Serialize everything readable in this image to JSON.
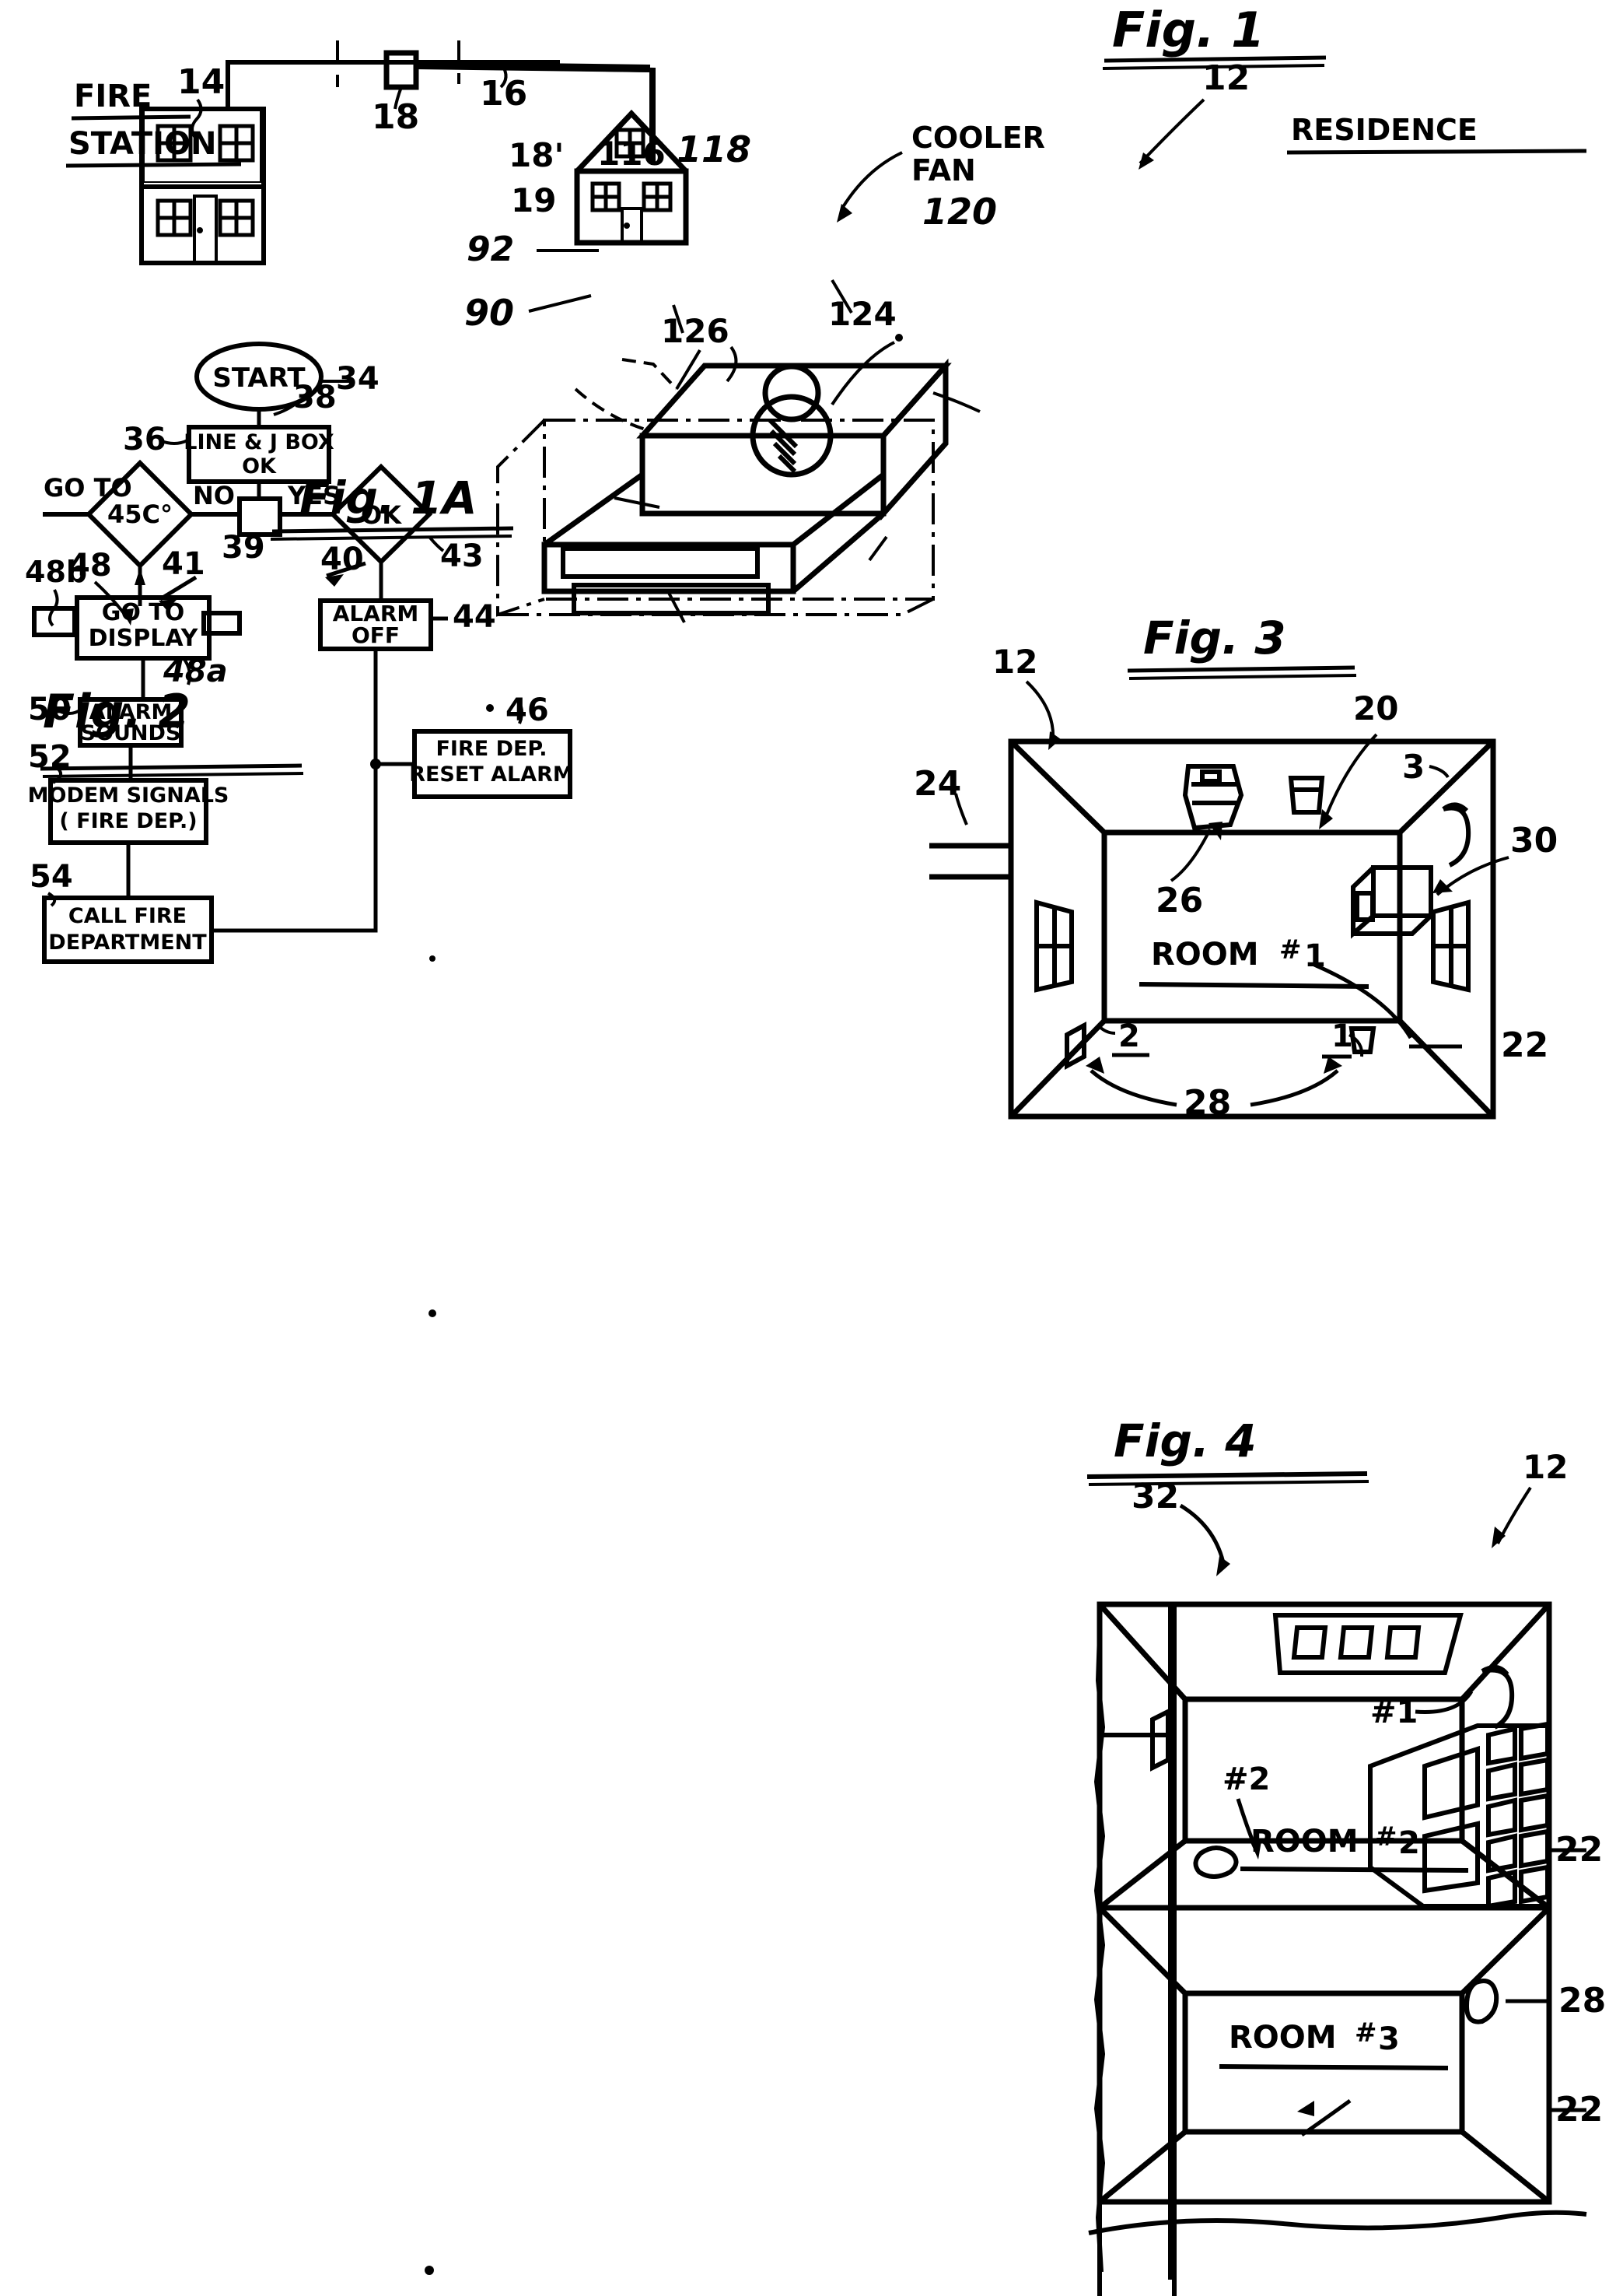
{
  "sheet": {
    "kind": "patent-drawing-sheet",
    "figures": [
      "Fig. 1",
      "Fig. 1A",
      "Fig. 2",
      "Fig. 3",
      "Fig. 4"
    ]
  },
  "fig1": {
    "title": "Fig. 1",
    "labels": {
      "fire_station": "FIRE\nSTATION",
      "fire_station_line1": "FIRE",
      "fire_station_line2": "STATION",
      "residence": "RESIDENCE"
    },
    "refs": {
      "fire_station_building": "14",
      "junction_box": "18",
      "line": "16",
      "residence_house": "12"
    }
  },
  "fig1a": {
    "title": "Fig. 1A",
    "labels": {
      "cooler_fan": "COOLER\nFAN",
      "cooler_fan_line1": "COOLER",
      "cooler_fan_line2": "FAN"
    },
    "refs": {
      "detail_jbox": "18'",
      "bracket": "116",
      "fan_shaft": "118",
      "enclosure_leader": "19",
      "fan_arrow": "120",
      "upper_slot": "92",
      "lower_slot": "90",
      "slot_leader": "126",
      "housing": "124"
    }
  },
  "fig2": {
    "title": "Fig. 2",
    "nodes": [
      {
        "id": "start",
        "ref": "34",
        "text": "START",
        "shape": "oval"
      },
      {
        "id": "lineok",
        "ref": "36",
        "text": "LINE & J BOX\nOK",
        "shape": "rect",
        "line1": "LINE & J BOX",
        "line2": "OK"
      },
      {
        "id": "dec45",
        "ref": "41",
        "text": "45C°",
        "shape": "diamond"
      },
      {
        "id": "conn",
        "ref": "39",
        "text": "",
        "shape": "small-rect"
      },
      {
        "id": "ok",
        "ref": "43",
        "text": "OK",
        "shape": "diamond"
      },
      {
        "id": "goto",
        "ref": "48",
        "text": "GO TO\nDISPLAY",
        "shape": "rect",
        "line1": "GO TO",
        "line2": "DISPLAY"
      },
      {
        "id": "alarmoff",
        "ref": "44",
        "text": "ALARM\nOFF",
        "shape": "rect",
        "line1": "ALARM",
        "line2": "OFF"
      },
      {
        "id": "sounds",
        "ref": "50",
        "text": "ALARM\nSOUNDS",
        "shape": "rect",
        "line1": "ALARM",
        "line2": "SOUNDS"
      },
      {
        "id": "reset",
        "ref": "46",
        "text": "FIRE DEP.\nRESET ALARM",
        "shape": "rect",
        "line1": "FIRE DEP.",
        "line2": "RESET ALARM"
      },
      {
        "id": "modem",
        "ref": "52",
        "text": "MODEM SIGNALS\n( FIRE DEP.)",
        "shape": "rect",
        "line1": "MODEM SIGNALS",
        "line2": "( FIRE DEP.)"
      },
      {
        "id": "call",
        "ref": "54",
        "text": "CALL FIRE\nDEPARTMENT",
        "shape": "rect",
        "line1": "CALL FIRE",
        "line2": "DEPARTMENT"
      }
    ],
    "edge_labels": {
      "goto_left": "GO TO",
      "no": "NO",
      "yes": "YES"
    },
    "refs": {
      "start": "34",
      "start_stem": "38",
      "lineok": "36",
      "connector": "39",
      "decision_out": "41",
      "ok_diamond": "43",
      "ok_out": "40",
      "alarm_off": "44",
      "reset_alarm": "46",
      "goto_display": "48",
      "goto_display_box": "48a",
      "aux_box": "48b",
      "alarm_sounds": "50",
      "modem_signals": "52",
      "call_fire": "54"
    }
  },
  "fig3": {
    "title": "Fig. 3",
    "labels": {
      "room": "ROOM  #1",
      "room_word": "ROOM",
      "room_hash": "#",
      "room_num": "1",
      "sensor_two": "2",
      "sensor_one": "1",
      "wall_ref": "3"
    },
    "refs": {
      "residence": "12",
      "ceiling": "20",
      "incoming_line": "24",
      "appliance": "26",
      "wall_unit": "30",
      "room_label_leader": "22",
      "detectors": "28"
    }
  },
  "fig4": {
    "title": "Fig. 4",
    "labels": {
      "room2": "ROOM  #2",
      "room2_word": "ROOM",
      "room2_hash": "#",
      "room2_num": "2",
      "room3": "ROOM  #3",
      "room3_word": "ROOM",
      "room3_hash": "#",
      "room3_num": "3",
      "marker1": "#1",
      "marker2": "#2"
    },
    "refs": {
      "residence": "12",
      "vent": "32",
      "room2_leader": "22",
      "room3_leader": "22",
      "detector": "28"
    }
  },
  "style": {
    "ink": "#000000",
    "paper": "#ffffff"
  }
}
